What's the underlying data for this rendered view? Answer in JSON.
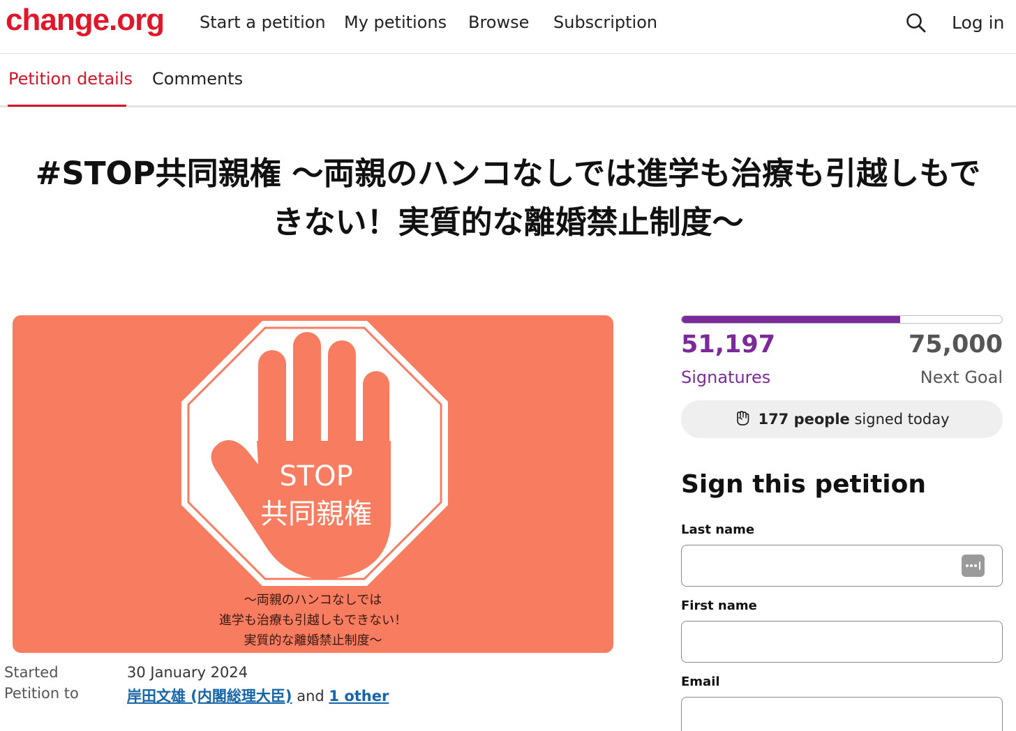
{
  "brand": {
    "logo_text": "change.org",
    "accent": "#e0162b",
    "signature_color": "#7b2a9a"
  },
  "nav": {
    "links": [
      "Start a petition",
      "My petitions",
      "Browse",
      "Subscription"
    ],
    "search_icon": "search-icon",
    "login_label": "Log in"
  },
  "tabs": [
    {
      "label": "Petition details",
      "active": true
    },
    {
      "label": "Comments",
      "active": false
    }
  ],
  "petition": {
    "title_line1": "#STOP共同親権 〜両親のハンコなしでは進学も治療も引越しもで",
    "title_line2": "きない！実質的な離婚禁止制度〜",
    "image": {
      "background": "#f77c60",
      "sign_text": "STOP",
      "sign_text_jp": "共同親権",
      "caption_lines": [
        "〜両親のハンコなしでは",
        "進学も治療も引越しもできない！",
        "実質的な離婚禁止制度〜"
      ]
    },
    "started_label": "Started",
    "started_date": "30 January 2024",
    "petition_to_label": "Petition to",
    "petition_to_target": "岸田文雄 (内閣総理大臣)",
    "petition_to_and": "and",
    "petition_to_other": "1 other"
  },
  "stats": {
    "signatures": "51,197",
    "signatures_label": "Signatures",
    "goal": "75,000",
    "goal_label": "Next Goal",
    "progress_fraction": 0.6826,
    "today_count": "177 people",
    "today_suffix": "signed today",
    "today_icon": "raised-fist-icon"
  },
  "sign_form": {
    "heading": "Sign this petition",
    "last_name_label": "Last name",
    "last_name_value": "",
    "first_name_label": "First name",
    "first_name_value": "",
    "email_label": "Email",
    "email_value": "",
    "password_manager_icon": "password-manager-icon"
  }
}
